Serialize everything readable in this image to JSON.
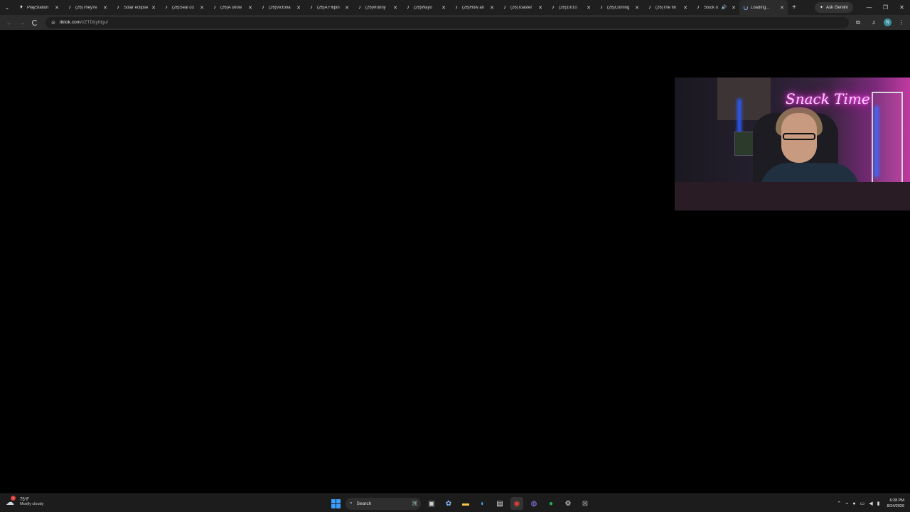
{
  "browser": {
    "tabs": [
      {
        "label": "PlayStation",
        "favicon": "playstation-icon"
      },
      {
        "label": "(26)They're",
        "favicon": "tiktok-icon"
      },
      {
        "label": "Solar eclipse",
        "favicon": "tiktok-icon"
      },
      {
        "label": "(26)Seal co",
        "favicon": "tiktok-icon"
      },
      {
        "label": "(26)A snow",
        "favicon": "tiktok-icon"
      },
      {
        "label": "(26)Victoria",
        "favicon": "tiktok-icon"
      },
      {
        "label": "(26)A Filipin",
        "favicon": "tiktok-icon"
      },
      {
        "label": "(26)#funny",
        "favicon": "tiktok-icon"
      },
      {
        "label": "(26)Wayo",
        "favicon": "tiktok-icon"
      },
      {
        "label": "(26)How an",
        "favicon": "tiktok-icon"
      },
      {
        "label": "(26)Toaster",
        "favicon": "tiktok-icon"
      },
      {
        "label": "(26)10/10",
        "favicon": "tiktok-icon"
      },
      {
        "label": "(26)Coming",
        "favicon": "tiktok-icon"
      },
      {
        "label": "(26)The fin",
        "favicon": "tiktok-icon"
      },
      {
        "label": "Stuck o",
        "favicon": "tiktok-icon",
        "audio": true
      },
      {
        "label": "Loading...",
        "favicon": "loading-spinner",
        "active": true
      }
    ],
    "ask_gemini_label": "Ask Gemini",
    "url_host": "tiktok.com",
    "url_path": "/t/ZTDkyfdgu/",
    "profile_initial": "N"
  },
  "webcam": {
    "neon_sign_text": "Snack Time"
  },
  "taskbar": {
    "weather": {
      "temp": "75°F",
      "description": "Mostly cloudy",
      "badge": "1"
    },
    "search_label": "Search",
    "clock": {
      "time": "6:28 PM",
      "date": "8/24/2026"
    }
  },
  "colors": {
    "page_background": "#000000",
    "tab_strip": "#1f1f1f",
    "toolbar": "#2c2c2c",
    "taskbar": "#1c1c1c",
    "neon_pink": "#ff2bd6",
    "windows_blue": "#3aa0ff"
  }
}
